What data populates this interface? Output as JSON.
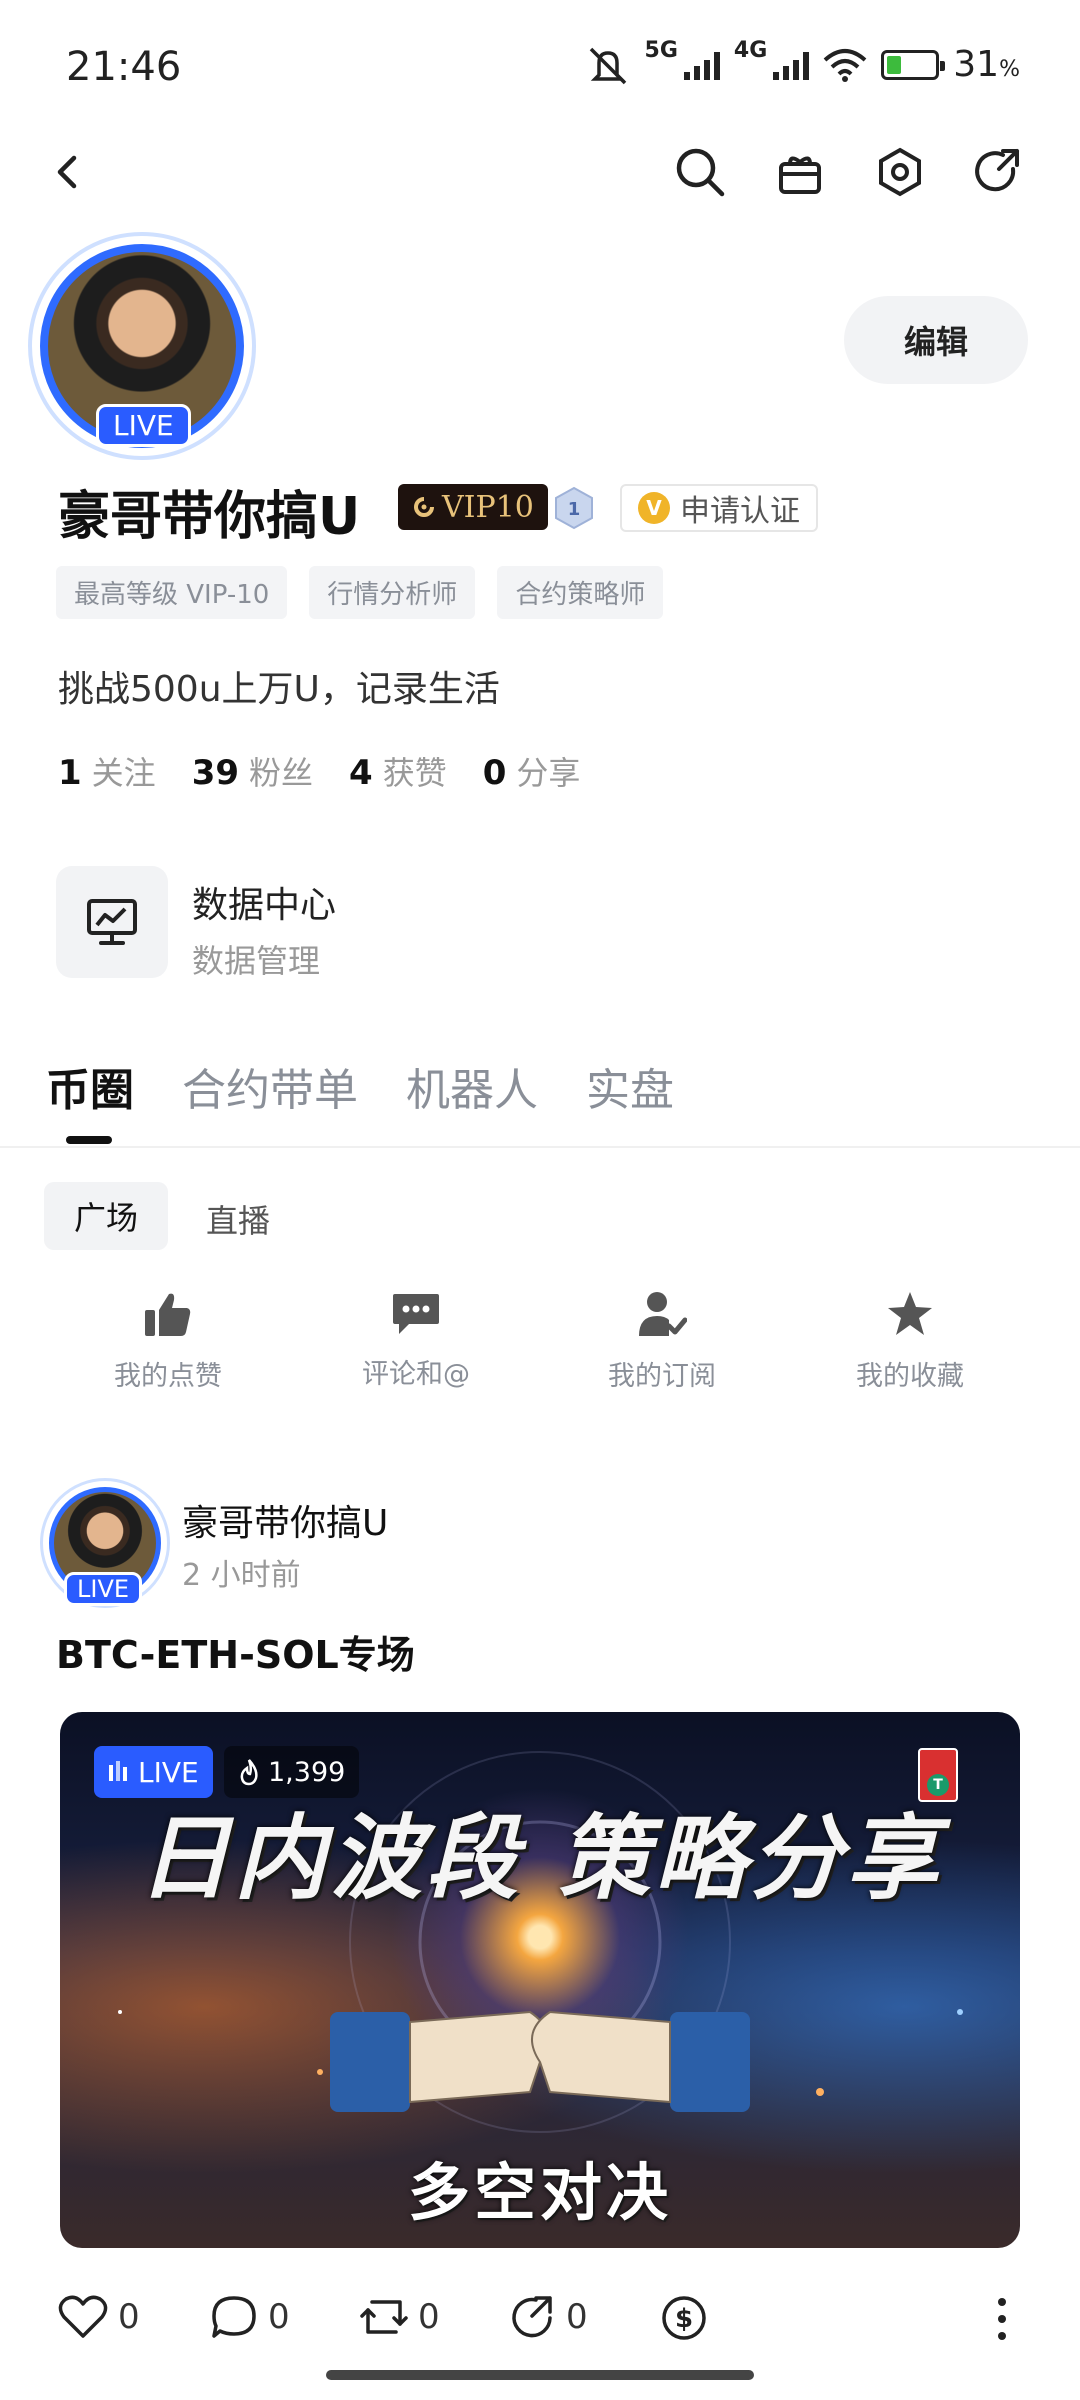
{
  "status_bar": {
    "time": "21:46",
    "network_5g": "5G",
    "network_4g": "4G",
    "battery_percent": "31",
    "battery_unit": "%",
    "battery_level": 0.31,
    "battery_color": "#3dbb3d"
  },
  "top_bar": {
    "icons": [
      "back-icon",
      "search-icon",
      "gift-icon",
      "settings-icon",
      "share-icon"
    ]
  },
  "profile": {
    "avatar_live_label": "LIVE",
    "edit_label": "编辑",
    "name": "豪哥带你搞U",
    "vip_label": "VIP10",
    "level_number": "1",
    "certify_label": "申请认证",
    "certify_icon_letter": "V",
    "tags": [
      "最高等级 VIP-10",
      "行情分析师",
      "合约策略师"
    ],
    "bio": "挑战500u上万U，记录生活",
    "stats": [
      {
        "value": "1",
        "label": "关注"
      },
      {
        "value": "39",
        "label": "粉丝"
      },
      {
        "value": "4",
        "label": "获赞"
      },
      {
        "value": "0",
        "label": "分享"
      }
    ]
  },
  "data_center": {
    "title": "数据中心",
    "subtitle": "数据管理"
  },
  "tabs": [
    "币圈",
    "合约带单",
    "机器人",
    "实盘"
  ],
  "subtabs": [
    "广场",
    "直播"
  ],
  "shortcuts": [
    {
      "label": "我的点赞",
      "icon": "thumbs-up-icon"
    },
    {
      "label": "评论和@",
      "icon": "comment-icon"
    },
    {
      "label": "我的订阅",
      "icon": "subscribe-icon"
    },
    {
      "label": "我的收藏",
      "icon": "star-icon"
    }
  ],
  "post": {
    "author": "豪哥带你搞U",
    "time": "2 小时前",
    "avatar_live_label": "LIVE",
    "title": "BTC-ETH-SOL专场",
    "cover": {
      "live_label": "LIVE",
      "viewers": "1,399",
      "badge_letter": "T",
      "headline": "日内波段 策略分享",
      "subtitle": "多空对决"
    },
    "actions": [
      {
        "icon": "heart-icon",
        "count": "0"
      },
      {
        "icon": "comment-icon",
        "count": "0"
      },
      {
        "icon": "repost-icon",
        "count": "0"
      },
      {
        "icon": "forward-icon",
        "count": "0"
      },
      {
        "icon": "tip-icon",
        "count": ""
      }
    ]
  },
  "colors": {
    "accent_blue": "#2a5cff",
    "vip_gold": "#e8c27a",
    "muted_text": "#8a8f98"
  }
}
